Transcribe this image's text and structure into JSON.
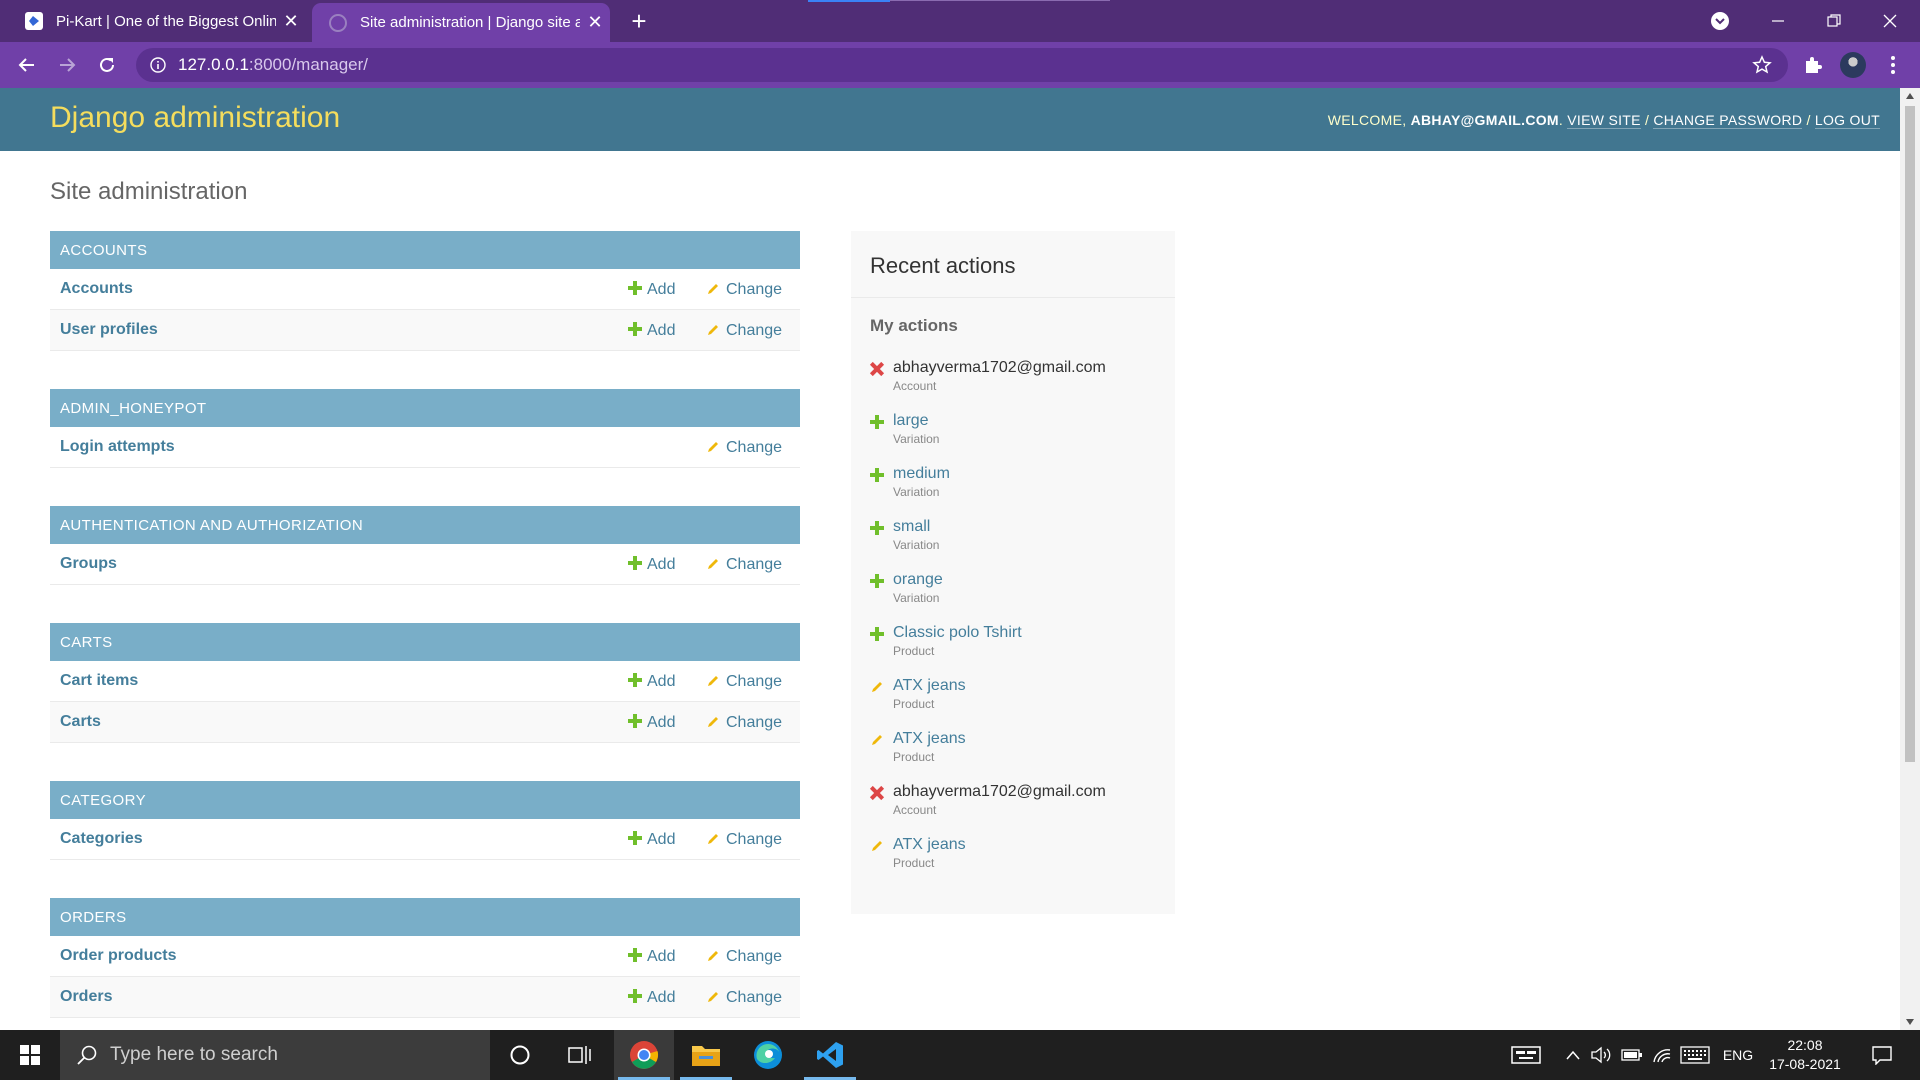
{
  "browser": {
    "tabs": [
      {
        "title": "Pi-Kart | One of the Biggest Onlin",
        "active": false
      },
      {
        "title": "Site administration | Django site a",
        "active": true
      }
    ],
    "new_tab_label": "+",
    "url_host": "127.0.0.1",
    "url_path": ":8000/manager/"
  },
  "header": {
    "branding": "Django administration",
    "welcome_prefix": "WELCOME, ",
    "username": "ABHAY@GMAIL.COM",
    "welcome_suffix": ". ",
    "view_site": "VIEW SITE",
    "change_password": "CHANGE PASSWORD",
    "log_out": "LOG OUT",
    "separator": " / "
  },
  "site_title": "Site administration",
  "labels": {
    "add": "Add",
    "change": "Change"
  },
  "modules": [
    {
      "caption": "ACCOUNTS",
      "models": [
        {
          "name": "Accounts",
          "add": true
        },
        {
          "name": "User profiles",
          "add": true
        }
      ]
    },
    {
      "caption": "ADMIN_HONEYPOT",
      "models": [
        {
          "name": "Login attempts",
          "add": false
        }
      ]
    },
    {
      "caption": "AUTHENTICATION AND AUTHORIZATION",
      "models": [
        {
          "name": "Groups",
          "add": true
        }
      ]
    },
    {
      "caption": "CARTS",
      "models": [
        {
          "name": "Cart items",
          "add": true
        },
        {
          "name": "Carts",
          "add": true
        }
      ]
    },
    {
      "caption": "CATEGORY",
      "models": [
        {
          "name": "Categories",
          "add": true
        }
      ]
    },
    {
      "caption": "ORDERS",
      "models": [
        {
          "name": "Order products",
          "add": true
        },
        {
          "name": "Orders",
          "add": true
        }
      ]
    }
  ],
  "recent_actions": {
    "title": "Recent actions",
    "subtitle": "My actions",
    "items": [
      {
        "kind": "deletion",
        "icon": "delete-icon",
        "label": "abhayverma1702@gmail.com",
        "type": "Account"
      },
      {
        "kind": "addition",
        "icon": "add-icon",
        "label": "large",
        "type": "Variation"
      },
      {
        "kind": "addition",
        "icon": "add-icon",
        "label": "medium",
        "type": "Variation"
      },
      {
        "kind": "addition",
        "icon": "add-icon",
        "label": "small",
        "type": "Variation"
      },
      {
        "kind": "addition",
        "icon": "add-icon",
        "label": "orange",
        "type": "Variation"
      },
      {
        "kind": "addition",
        "icon": "add-icon",
        "label": "Classic polo Tshirt",
        "type": "Product"
      },
      {
        "kind": "change",
        "icon": "pencil-icon",
        "label": "ATX jeans",
        "type": "Product"
      },
      {
        "kind": "change",
        "icon": "pencil-icon",
        "label": "ATX jeans",
        "type": "Product"
      },
      {
        "kind": "deletion",
        "icon": "delete-icon",
        "label": "abhayverma1702@gmail.com",
        "type": "Account"
      },
      {
        "kind": "change",
        "icon": "pencil-icon",
        "label": "ATX jeans",
        "type": "Product"
      }
    ]
  },
  "taskbar": {
    "search_placeholder": "Type here to search",
    "language": "ENG",
    "time": "22:08",
    "date": "17-08-2021"
  },
  "colors": {
    "header_bg": "#417690",
    "branding": "#f5dd5d",
    "module_caption_bg": "#79aec8",
    "link": "#447e9b",
    "add_green": "#70bf2b",
    "change_yellow": "#efb80b",
    "delete_red": "#dd4646",
    "chrome_tabbar": "#502d76",
    "chrome_toolbar": "#7040a8"
  }
}
